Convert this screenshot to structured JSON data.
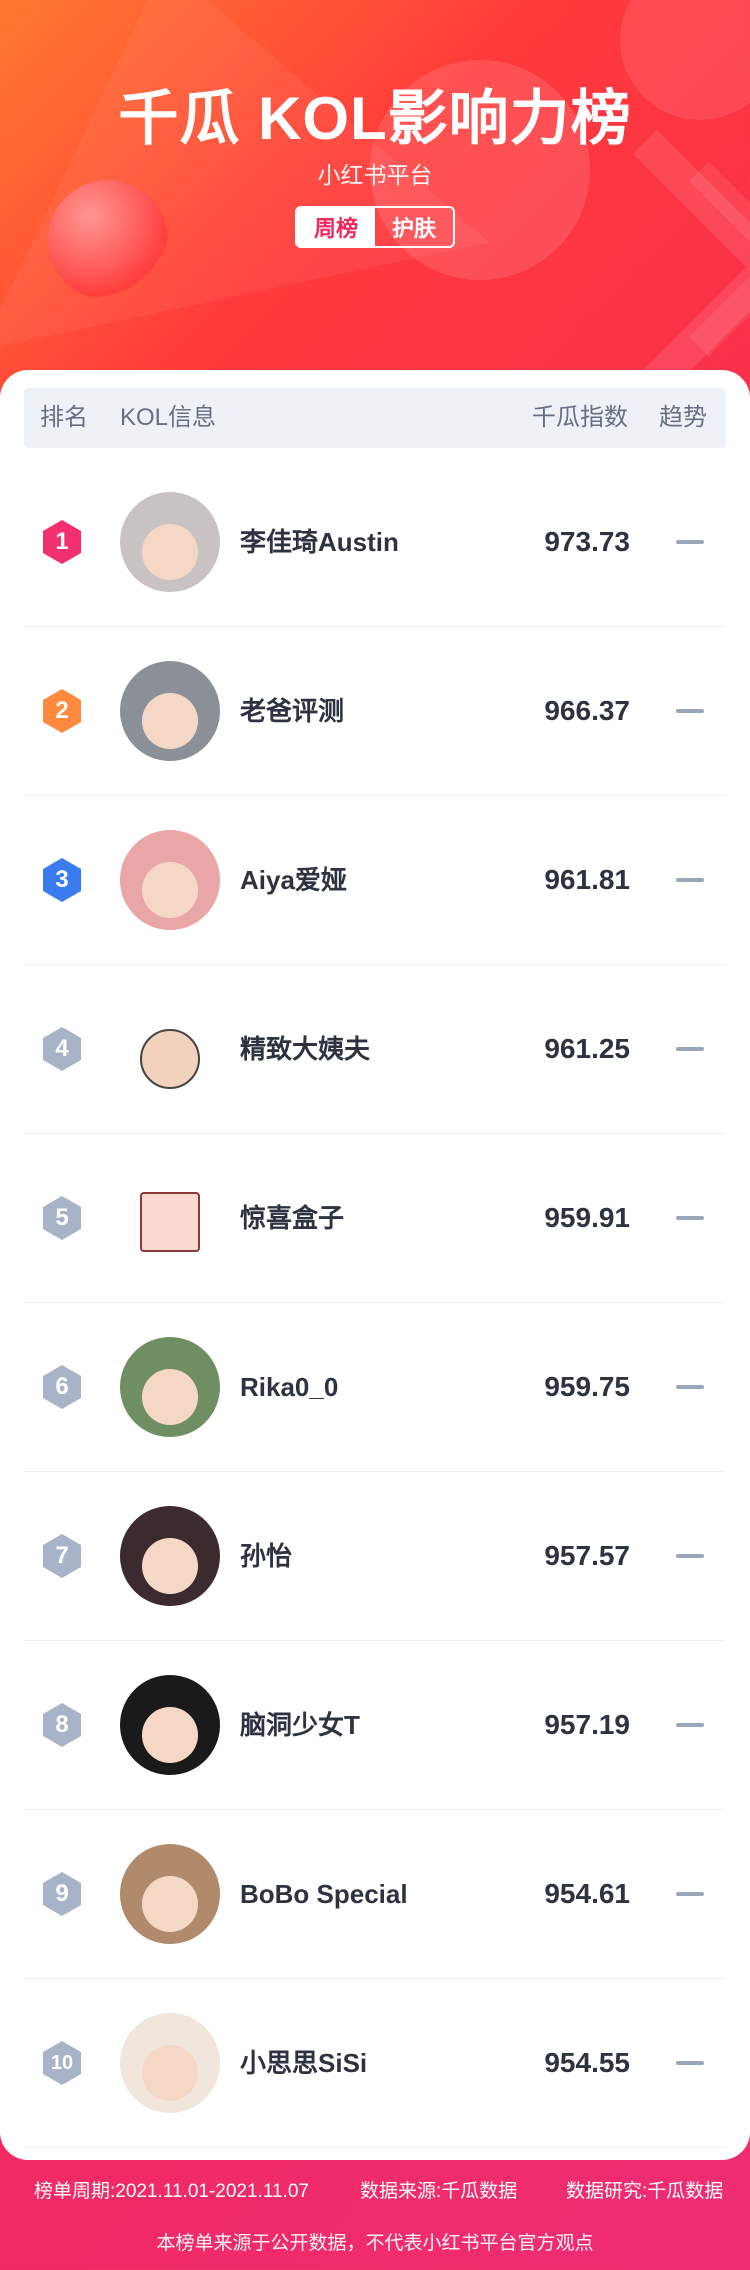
{
  "header": {
    "title": "千瓜 KOL影响力榜",
    "subtitle": "小红书平台",
    "tags": [
      "周榜",
      "护肤"
    ]
  },
  "table": {
    "columns": [
      "排名",
      "KOL信息",
      "千瓜指数",
      "趋势"
    ],
    "rows": [
      {
        "rank": "1",
        "name": "李佳琦Austin",
        "score": "973.73"
      },
      {
        "rank": "2",
        "name": "老爸评测",
        "score": "966.37"
      },
      {
        "rank": "3",
        "name": "Aiya爱娅",
        "score": "961.81"
      },
      {
        "rank": "4",
        "name": "精致大姨夫",
        "score": "961.25"
      },
      {
        "rank": "5",
        "name": "惊喜盒子",
        "score": "959.91"
      },
      {
        "rank": "6",
        "name": "Rika0_0",
        "score": "959.75"
      },
      {
        "rank": "7",
        "name": "孙怡",
        "score": "957.57"
      },
      {
        "rank": "8",
        "name": "脑洞少女T",
        "score": "957.19"
      },
      {
        "rank": "9",
        "name": "BoBo Special",
        "score": "954.61"
      },
      {
        "rank": "10",
        "name": "小思思SiSi",
        "score": "954.55"
      }
    ]
  },
  "footer": {
    "period": "榜单周期:2021.11.01-2021.11.07",
    "source": "数据来源:千瓜数据",
    "research": "数据研究:千瓜数据",
    "disclaimer": "本榜单来源于公开数据，不代表小红书平台官方观点"
  },
  "colors": {
    "rank1": "#f2306e",
    "rank2": "#ff8a3d",
    "rank3": "#3b7bf0",
    "rank_other": "#a9b3c8",
    "trend": "#9aa7bb"
  }
}
